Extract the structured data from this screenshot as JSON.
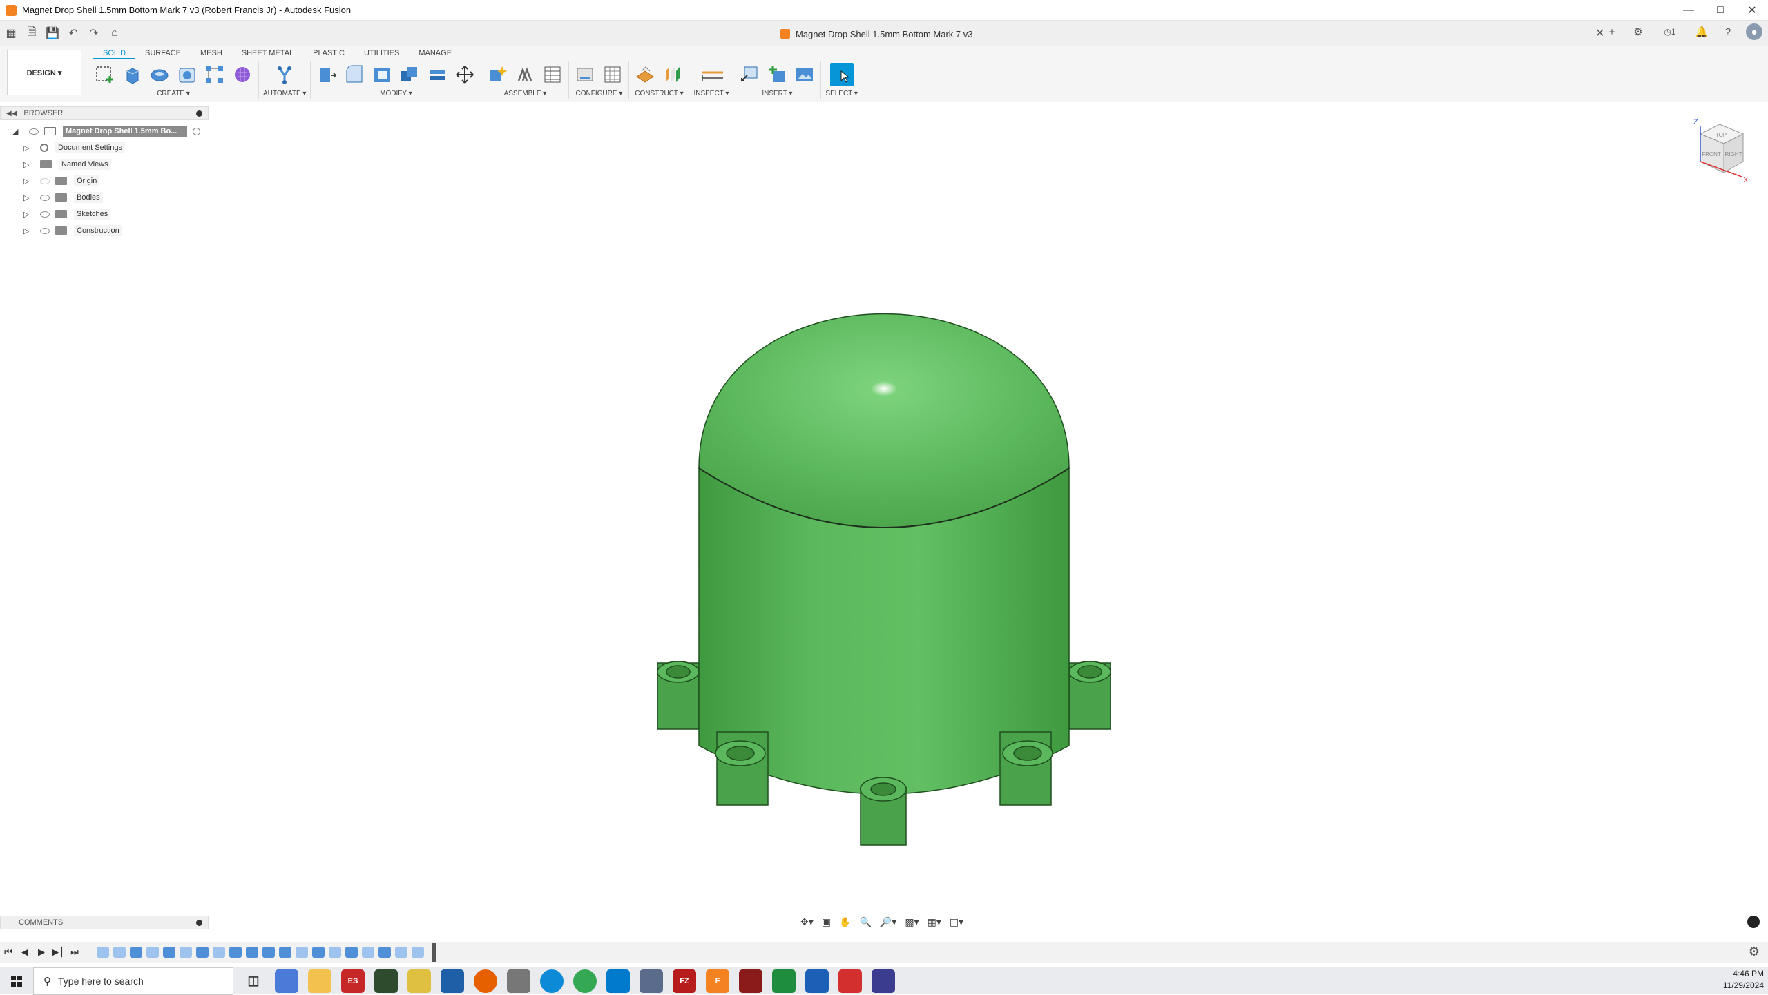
{
  "window": {
    "title": "Magnet Drop Shell 1.5mm Bottom Mark 7 v3 (Robert Francis Jr) - Autodesk Fusion",
    "controls": [
      "minimize",
      "maximize",
      "close"
    ]
  },
  "doc_tab": {
    "label": "Magnet Drop Shell 1.5mm Bottom Mark 7 v3",
    "notification_count": "1"
  },
  "workspace": {
    "label": "DESIGN ▾"
  },
  "ribbon_tabs": [
    "SOLID",
    "SURFACE",
    "MESH",
    "SHEET METAL",
    "PLASTIC",
    "UTILITIES",
    "MANAGE"
  ],
  "active_tab": "SOLID",
  "tool_groups": [
    {
      "label": "CREATE ▾"
    },
    {
      "label": "AUTOMATE ▾"
    },
    {
      "label": "MODIFY ▾"
    },
    {
      "label": "ASSEMBLE ▾"
    },
    {
      "label": "CONFIGURE ▾"
    },
    {
      "label": "CONSTRUCT ▾"
    },
    {
      "label": "INSPECT ▾"
    },
    {
      "label": "INSERT ▾"
    },
    {
      "label": "SELECT ▾"
    }
  ],
  "browser": {
    "title": "BROWSER",
    "root": "Magnet Drop Shell 1.5mm Bo...",
    "items": [
      {
        "label": "Document Settings"
      },
      {
        "label": "Named Views"
      },
      {
        "label": "Origin"
      },
      {
        "label": "Bodies"
      },
      {
        "label": "Sketches"
      },
      {
        "label": "Construction"
      }
    ]
  },
  "viewcube": {
    "top": "TOP",
    "front": "FRONT",
    "right": "RIGHT",
    "axis_z": "Z",
    "axis_x": "X"
  },
  "comments": {
    "title": "COMMENTS"
  },
  "taskbar": {
    "search_placeholder": "Type here to search",
    "time": "4:46 PM",
    "date": "11/29/2024"
  },
  "colors": {
    "accent": "#0696d7",
    "model": "#5cb85c",
    "model_dark": "#3f9a3f"
  }
}
